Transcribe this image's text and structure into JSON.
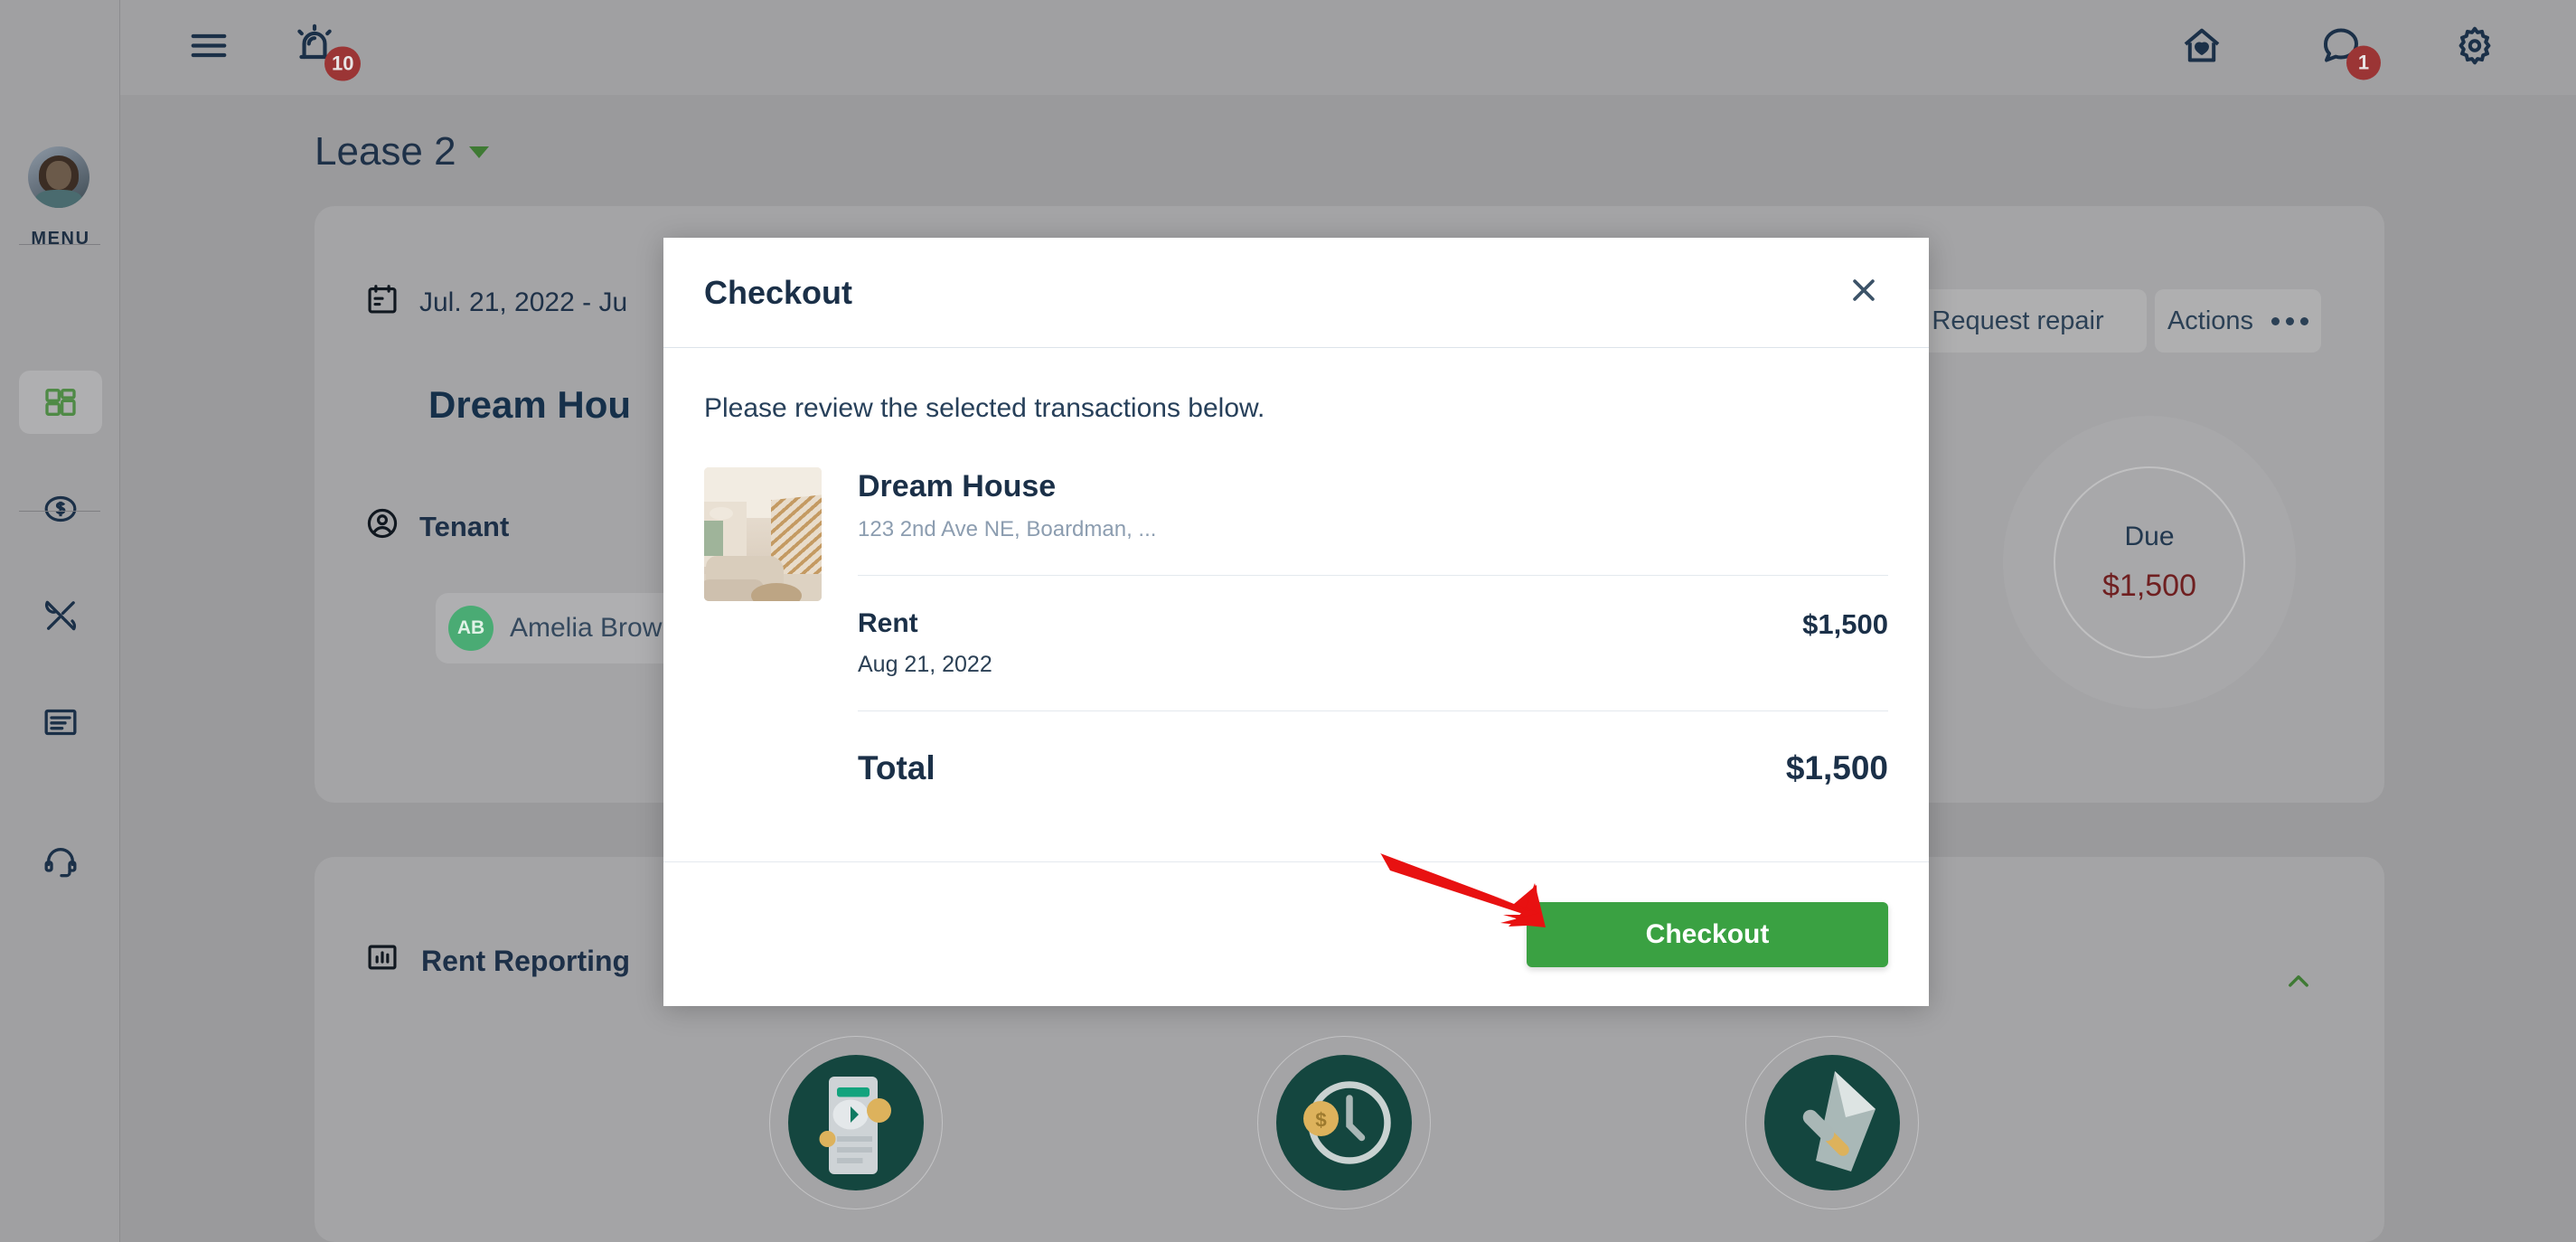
{
  "topbar": {
    "menu_icon": "hamburger-menu-icon",
    "alert_icon": "alarm-bell-icon",
    "alert_badge": "10",
    "home_icon": "house-heart-icon",
    "chat_icon": "chat-bubble-icon",
    "chat_badge": "1",
    "settings_icon": "gear-icon"
  },
  "sidebar": {
    "menu_label": "MENU",
    "avatar_name": "user-avatar",
    "items": [
      {
        "name": "dashboard",
        "icon": "grid-dashboard-icon",
        "active": true
      },
      {
        "name": "payments",
        "icon": "dollar-circle-icon",
        "active": false
      },
      {
        "name": "maintenance",
        "icon": "tools-icon",
        "active": false
      },
      {
        "name": "documents",
        "icon": "document-icon",
        "active": false
      },
      {
        "name": "support",
        "icon": "headset-icon",
        "active": false
      }
    ]
  },
  "page": {
    "lease_title": "Lease 2",
    "date_range": "Jul. 21, 2022 - Ju",
    "property_title": "Dream Hou",
    "tenant_label": "Tenant",
    "tenant_initials": "AB",
    "tenant_name": "Amelia Brow",
    "request_repair_label": "Request repair",
    "actions_label": "Actions",
    "due_label": "Due",
    "due_amount": "$1,500",
    "rent_reporting_label": "Rent Reporting",
    "accent_green": "#3aa142",
    "due_red": "#6f1f20"
  },
  "modal": {
    "title": "Checkout",
    "close_icon": "close-x-icon",
    "review_text": "Please review the selected transactions below.",
    "property": {
      "name": "Dream House",
      "address": "123 2nd Ave NE, Boardman, ...",
      "thumbnail": "property-interior-photo"
    },
    "charges": [
      {
        "label": "Rent",
        "date": "Aug 21, 2022",
        "amount": "$1,500"
      }
    ],
    "total_label": "Total",
    "total_amount": "$1,500",
    "checkout_label": "Checkout",
    "checkout_color": "#3aa142"
  },
  "annotation": {
    "arrow_color": "#e81111",
    "points_to": "checkout-button"
  }
}
